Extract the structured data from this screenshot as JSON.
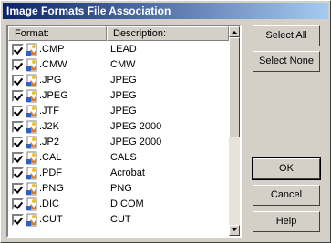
{
  "window": {
    "title": "Image Formats File Association"
  },
  "list": {
    "columns": [
      "Format:",
      "Description:"
    ],
    "rows": [
      {
        "format": ".CMP",
        "description": "LEAD",
        "checked": true
      },
      {
        "format": ".CMW",
        "description": "CMW",
        "checked": true
      },
      {
        "format": ".JPG",
        "description": "JPEG",
        "checked": true
      },
      {
        "format": ".JPEG",
        "description": "JPEG",
        "checked": true
      },
      {
        "format": ".JTF",
        "description": "JPEG",
        "checked": true
      },
      {
        "format": ".J2K",
        "description": "JPEG 2000",
        "checked": true
      },
      {
        "format": ".JP2",
        "description": "JPEG 2000",
        "checked": true
      },
      {
        "format": ".CAL",
        "description": "CALS",
        "checked": true
      },
      {
        "format": ".PDF",
        "description": "Acrobat",
        "checked": true
      },
      {
        "format": ".PNG",
        "description": "PNG",
        "checked": true
      },
      {
        "format": ".DIC",
        "description": "DICOM",
        "checked": true
      },
      {
        "format": ".CUT",
        "description": "CUT",
        "checked": true
      }
    ]
  },
  "buttons": {
    "select_all": "Select All",
    "select_none": "Select None",
    "ok": "OK",
    "cancel": "Cancel",
    "help": "Help"
  },
  "icons": {
    "file": "image-file-icon",
    "scroll_up": "scroll-up-arrow-icon",
    "scroll_down": "scroll-down-arrow-icon"
  },
  "colors": {
    "titlebar_start": "#0a246a",
    "titlebar_end": "#a6caf0",
    "face": "#d4d0c8"
  }
}
